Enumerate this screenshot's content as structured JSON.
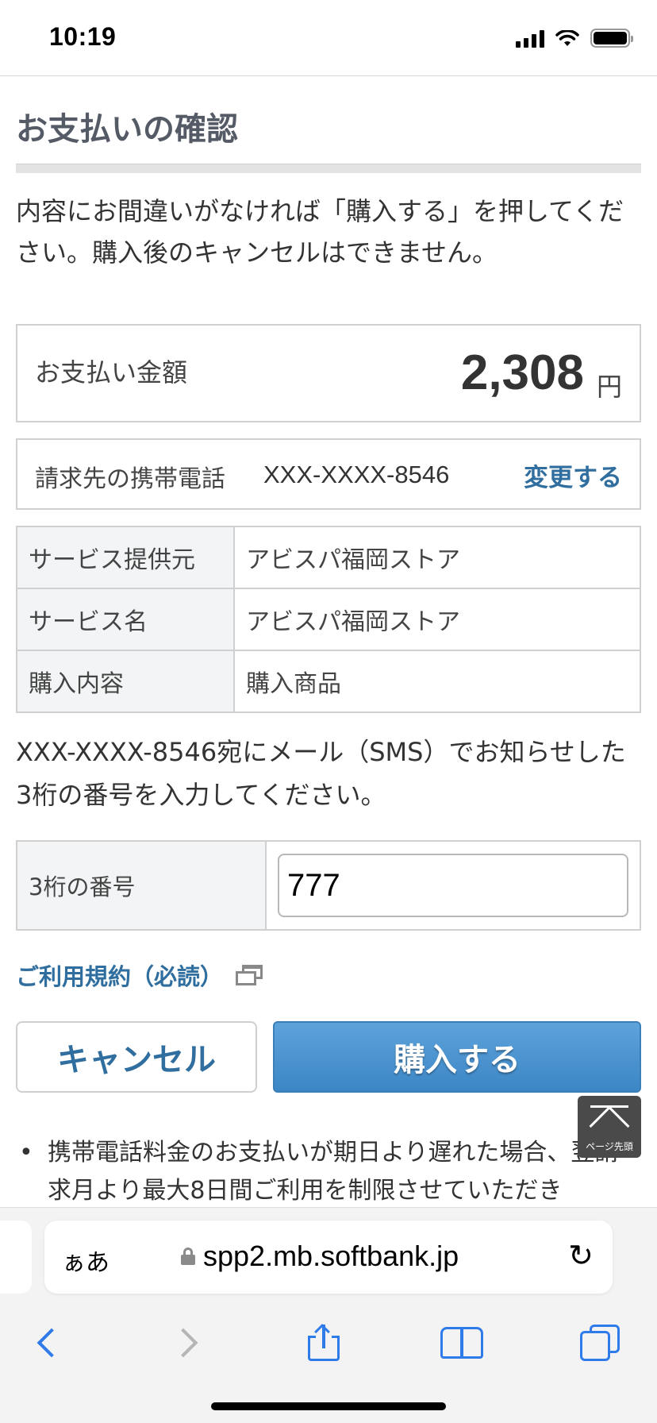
{
  "status_bar": {
    "time": "10:19",
    "icons": [
      "signal-icon",
      "wifi-icon",
      "battery-icon"
    ]
  },
  "page": {
    "title": "お支払いの確認",
    "intro": "内容にお間違いがなければ「購入する」を押してください。購入後のキャンセルはできません。",
    "amount": {
      "label": "お支払い金額",
      "value": "2,308",
      "unit": "円"
    },
    "billing": {
      "label": "請求先の携帯電話",
      "phone": "XXX-XXXX-8546",
      "change_label": "変更する"
    },
    "details": [
      {
        "label": "サービス提供元",
        "value": "アビスパ福岡ストア"
      },
      {
        "label": "サービス名",
        "value": "アビスパ福岡ストア"
      },
      {
        "label": "購入内容",
        "value": "購入商品"
      }
    ],
    "sms_note": "XXX-XXXX-8546宛にメール（SMS）でお知らせした3桁の番号を入力してください。",
    "code": {
      "label": "3桁の番号",
      "value": "777"
    },
    "terms_link": "ご利用規約（必読）",
    "buttons": {
      "cancel": "キャンセル",
      "buy": "購入する"
    },
    "notice_bullet": "•",
    "notice": "携帯電話料金のお支払いが期日より遅れた場合、翌請求月より最大8日間ご利用を制限させていただき",
    "page_top_label": "ページ先頭"
  },
  "browser": {
    "aa_label": "ぁあ",
    "url": "spp2.mb.softbank.jp",
    "reload_glyph": "↻"
  },
  "colors": {
    "link": "#2f6e9e",
    "buy_button": "#4a94d0",
    "ios_blue": "#2f7bea"
  }
}
